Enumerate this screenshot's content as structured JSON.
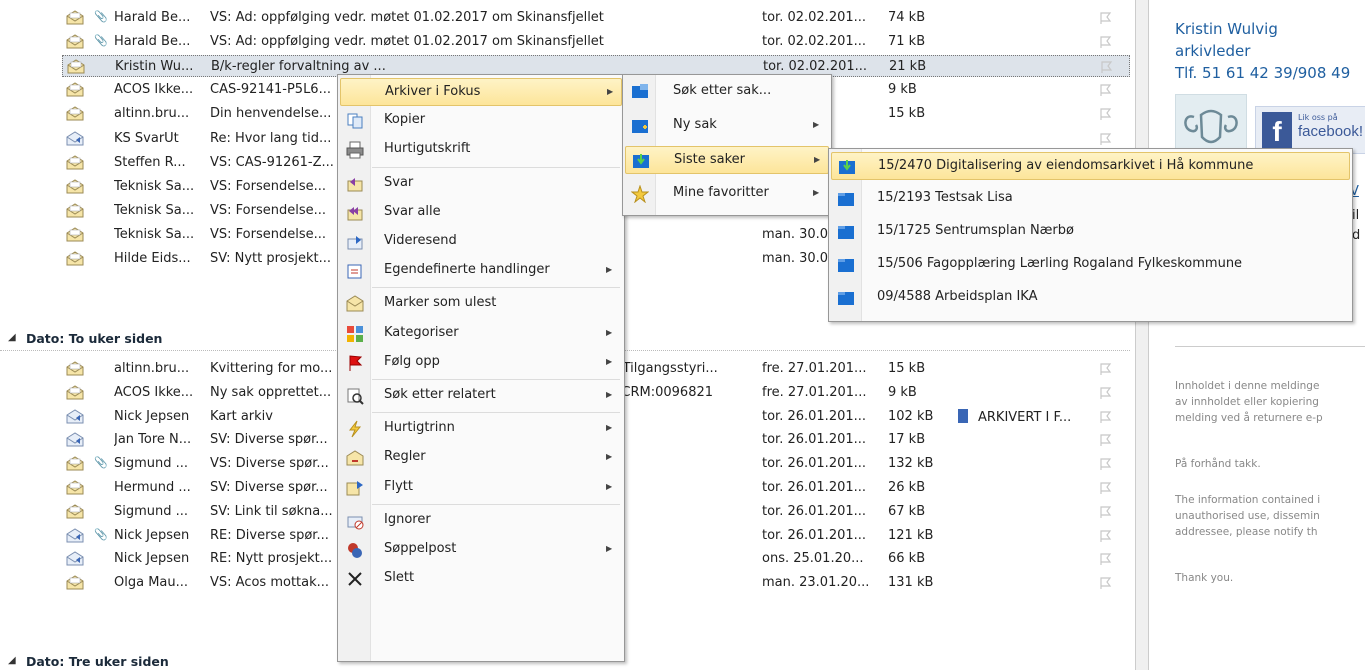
{
  "rows_top": [
    {
      "from": "Harald Be...",
      "clip": true,
      "subject": "VS: Ad: oppfølging vedr. møtet 01.02.2017 om Skinansfjellet",
      "date": "tor. 02.02.201...",
      "size": "74 kB",
      "icon": "envelope-open-icon"
    },
    {
      "from": "Harald Be...",
      "clip": true,
      "subject": "VS: Ad: oppfølging vedr. møtet 01.02.2017 om Skinansfjellet",
      "date": "tor. 02.02.201...",
      "size": "71 kB",
      "icon": "envelope-open-icon"
    },
    {
      "from": "Kristin Wu...",
      "clip": false,
      "subject": "B/k-regler forvaltning av ...",
      "date": "tor. 02.02.201...",
      "size": "21 kB",
      "icon": "envelope-open-icon",
      "selected": true
    },
    {
      "from": "ACOS Ikke...",
      "clip": false,
      "subject": "CAS-92141-P5L6...",
      "date": "2.20...",
      "size": "9 kB",
      "icon": "envelope-open-icon"
    },
    {
      "from": "altinn.bru...",
      "clip": false,
      "subject": "Din henvendelse...",
      "date": "2.20...",
      "size": "15 kB",
      "icon": "envelope-open-icon"
    },
    {
      "from": "KS SvarUt",
      "clip": false,
      "subject": "Re: Hvor lang tid...",
      "date": "",
      "size": "",
      "icon": "envelope-reply-icon"
    },
    {
      "from": "Steffen R...",
      "clip": false,
      "subject": "VS: CAS-91261-Z...",
      "date": "",
      "size": "",
      "icon": "envelope-open-icon"
    },
    {
      "from": "Teknisk Sa...",
      "clip": false,
      "subject": "VS: Forsendelse...",
      "date": "",
      "size": "",
      "icon": "envelope-open-icon"
    },
    {
      "from": "Teknisk Sa...",
      "clip": false,
      "subject": "VS: Forsendelse...",
      "date": "man. 30.0...",
      "size": "",
      "icon": "envelope-open-icon"
    },
    {
      "from": "Teknisk Sa...",
      "clip": false,
      "subject": "VS: Forsendelse...",
      "date": "man. 30.0...",
      "size": "",
      "icon": "envelope-open-icon"
    },
    {
      "from": "Hilde Eids...",
      "clip": false,
      "subject": "SV: Nytt prosjekt...",
      "date": "man. 30.0...",
      "size": "",
      "icon": "envelope-open-icon"
    }
  ],
  "group1": "Dato: To uker siden",
  "rows_group1": [
    {
      "from": "altinn.bru...",
      "clip": false,
      "subject": "Kvittering for mo...",
      "subject2": "]: Tilgangsstyri...",
      "date": "fre. 27.01.201...",
      "size": "15 kB",
      "icon": "envelope-open-icon"
    },
    {
      "from": "ACOS Ikke...",
      "clip": false,
      "subject": "Ny sak opprettet...",
      "subject2": "0 CRM:0096821",
      "date": "fre. 27.01.201...",
      "size": "9 kB",
      "icon": "envelope-open-icon"
    },
    {
      "from": "Nick Jepsen",
      "clip": false,
      "subject": "Kart arkiv",
      "date": "tor. 26.01.201...",
      "size": "102 kB",
      "icon": "envelope-reply-icon",
      "category": "ARKIVERT I F..."
    },
    {
      "from": "Jan Tore N...",
      "clip": false,
      "subject": "SV: Diverse spør...",
      "date": "tor. 26.01.201...",
      "size": "17 kB",
      "icon": "envelope-reply-icon"
    },
    {
      "from": "Sigmund ...",
      "clip": true,
      "subject": "VS: Diverse spør...",
      "date": "tor. 26.01.201...",
      "size": "132 kB",
      "icon": "envelope-open-icon"
    },
    {
      "from": "Hermund ...",
      "clip": false,
      "subject": "SV: Diverse spør...",
      "date": "tor. 26.01.201...",
      "size": "26 kB",
      "icon": "envelope-open-icon"
    },
    {
      "from": "Sigmund ...",
      "clip": false,
      "subject": "SV: Link til søkna...",
      "date": "tor. 26.01.201...",
      "size": "67 kB",
      "icon": "envelope-open-icon"
    },
    {
      "from": "Nick Jepsen",
      "clip": true,
      "subject": "RE: Diverse spør...",
      "date": "tor. 26.01.201...",
      "size": "121 kB",
      "icon": "envelope-reply-icon"
    },
    {
      "from": "Nick Jepsen",
      "clip": false,
      "subject": "RE: Nytt prosjekt...",
      "date": "ons. 25.01.20...",
      "size": "66 kB",
      "icon": "envelope-reply-icon"
    },
    {
      "from": "Olga Mau...",
      "clip": false,
      "subject": "VS: Acos mottak...",
      "date": "man. 23.01.20...",
      "size": "131 kB",
      "icon": "envelope-open-icon"
    }
  ],
  "group2": "Dato: Tre uker siden",
  "reading": {
    "name": "Kristin Wulvig",
    "title": "arkivleder",
    "phone": "Tlf. 51 61 42 39/908 49",
    "fb_small": "Lik oss på",
    "fb_big": "facebook!",
    "disclaimer1": [
      "Innholdet i denne meldinge",
      "av innholdet eller kopiering",
      "melding ved å returnere e-p"
    ],
    "disclaimer2": "På forhånd takk.",
    "disclaimer3": [
      "The information contained i",
      "unauthorised use, dissemin",
      "addressee, please notify th"
    ],
    "disclaimer4": "Thank you.",
    "frag1": "V",
    "frag2": "il",
    "frag3": "d"
  },
  "context_menu": [
    {
      "label": "Arkiver i Fokus",
      "icon": "none",
      "submenu": true,
      "highlighted": true
    },
    {
      "label": "Kopier",
      "icon": "copy-icon",
      "accel": "K"
    },
    {
      "label": "Hurtigutskrift",
      "icon": "print-icon"
    },
    {
      "sep": true
    },
    {
      "label": "Svar",
      "icon": "reply-icon"
    },
    {
      "label": "Svar alle",
      "icon": "reply-all-icon"
    },
    {
      "label": "Videresend",
      "icon": "forward-icon"
    },
    {
      "label": "Egendefinerte handlinger",
      "icon": "custom-actions-icon",
      "submenu": true
    },
    {
      "sep": true
    },
    {
      "label": "Marker som ulest",
      "icon": "mark-unread-icon"
    },
    {
      "label": "Kategoriser",
      "icon": "categorize-icon",
      "submenu": true
    },
    {
      "label": "Følg opp",
      "icon": "flag-icon",
      "submenu": true
    },
    {
      "sep": true
    },
    {
      "label": "Søk etter relatert",
      "icon": "search-related-icon",
      "submenu": true
    },
    {
      "sep": true
    },
    {
      "label": "Hurtigtrinn",
      "icon": "quicksteps-icon",
      "submenu": true
    },
    {
      "label": "Regler",
      "icon": "rules-icon",
      "submenu": true
    },
    {
      "label": "Flytt",
      "icon": "move-icon",
      "submenu": true
    },
    {
      "sep": true
    },
    {
      "label": "Ignorer",
      "icon": "ignore-icon"
    },
    {
      "label": "Søppelpost",
      "icon": "junk-icon",
      "submenu": true
    },
    {
      "label": "Slett",
      "icon": "delete-icon"
    }
  ],
  "fokus_menu": [
    {
      "label": "Søk etter sak...",
      "icon": "search-case-icon"
    },
    {
      "label": "Ny sak",
      "icon": "new-case-icon",
      "submenu": true
    },
    {
      "label": "Siste saker",
      "icon": "recent-cases-icon",
      "submenu": true,
      "highlighted": true
    },
    {
      "label": "Mine favoritter",
      "icon": "star-icon",
      "submenu": true
    }
  ],
  "recent_menu": [
    {
      "label": "15/2470 Digitalisering av eiendomsarkivet i Hå kommune",
      "highlighted": true
    },
    {
      "label": "15/2193 Testsak Lisa"
    },
    {
      "label": "15/1725 Sentrumsplan Nærbø"
    },
    {
      "label": "15/506 Fagopplæring Lærling Rogaland Fylkeskommune"
    },
    {
      "label": "09/4588 Arbeidsplan IKA"
    }
  ],
  "colors": {
    "accent_blue": "#1f5fa0",
    "highlight": "#fde59a",
    "category": "#3a66b5"
  }
}
